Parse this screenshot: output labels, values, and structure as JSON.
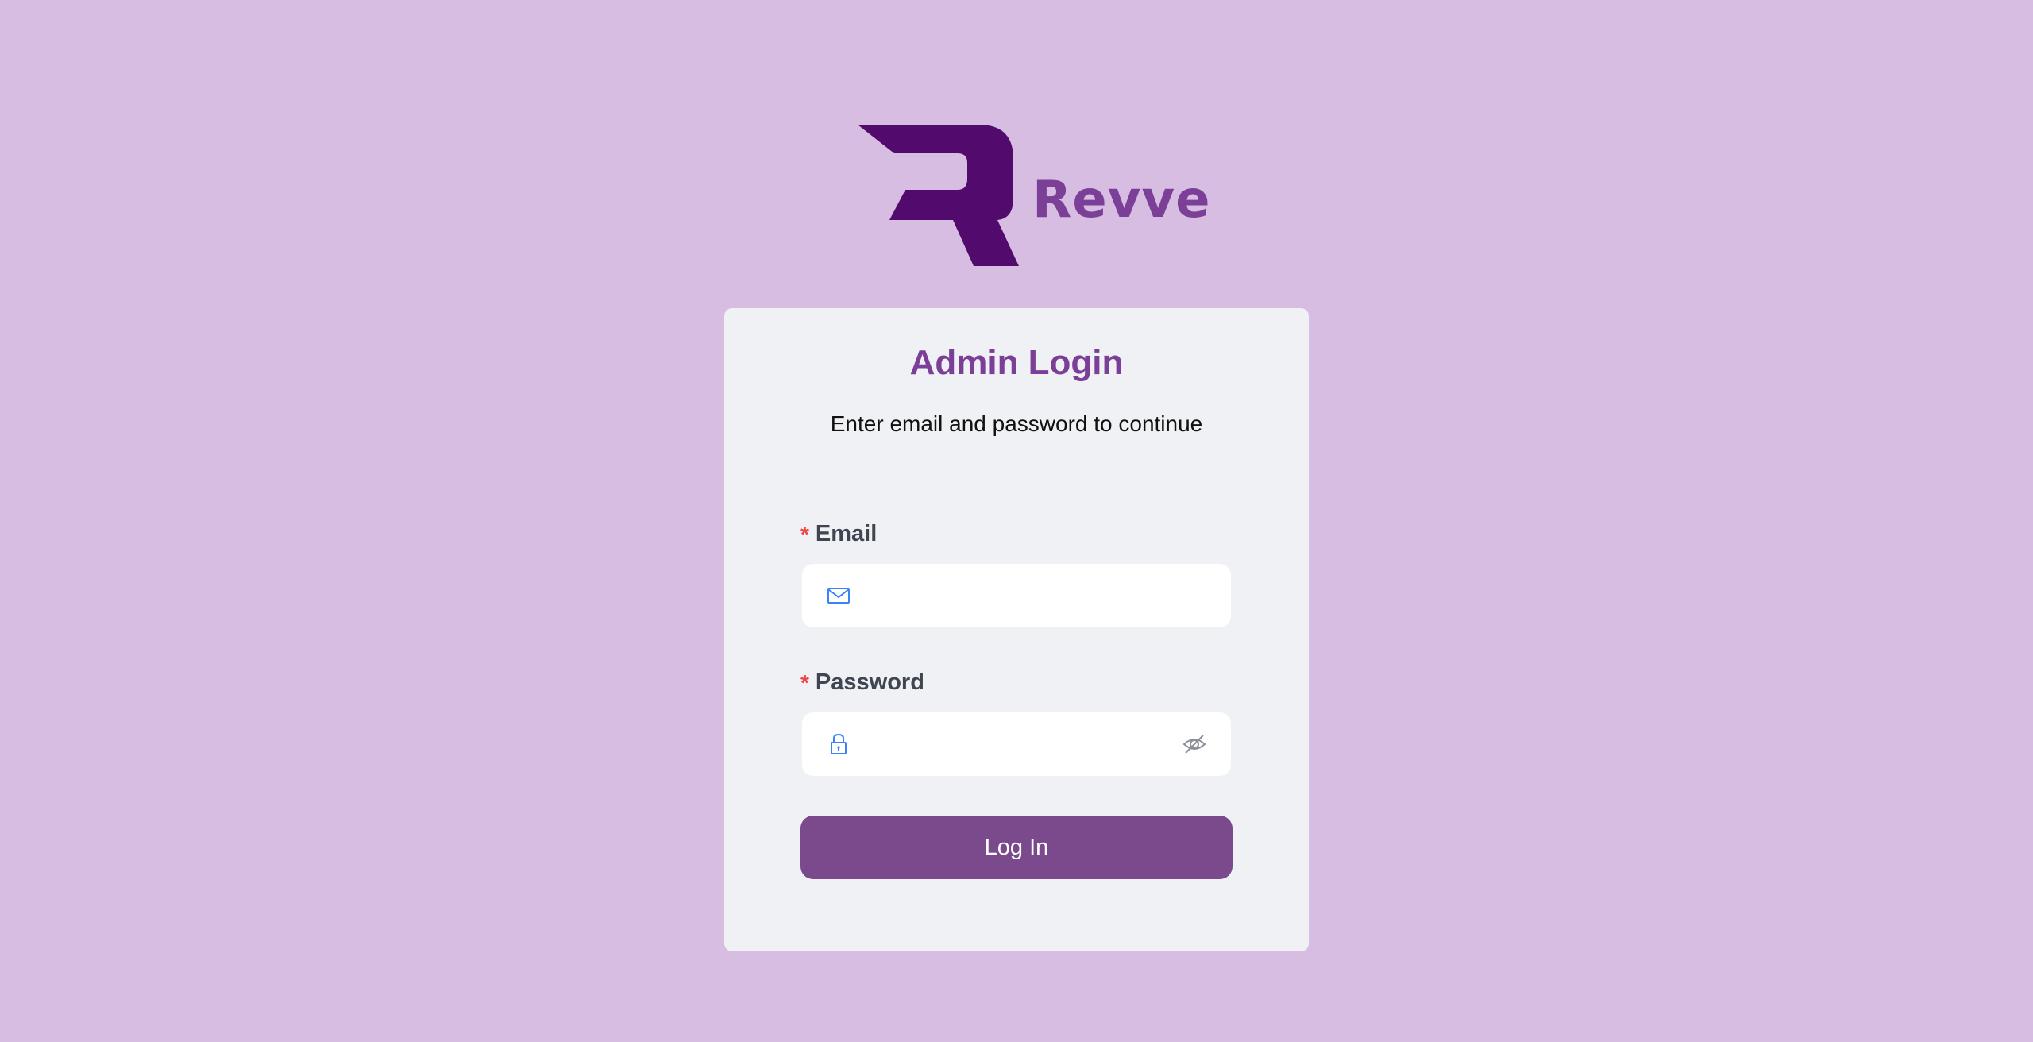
{
  "brand": {
    "name": "Revve",
    "mark_color": "#520a6d",
    "name_color": "#7c3f98"
  },
  "login": {
    "title": "Admin Login",
    "subtitle": "Enter email and password to continue",
    "title_color": "#7c3f98"
  },
  "fields": {
    "email": {
      "label": "Email",
      "required_marker": "*",
      "value": "",
      "icon": "mail-icon"
    },
    "password": {
      "label": "Password",
      "required_marker": "*",
      "value": "",
      "icon": "lock-icon",
      "toggle_icon": "eye-off-icon"
    }
  },
  "submit": {
    "label": "Log In",
    "color": "#7a4a8c"
  },
  "colors": {
    "background": "#d7bde2",
    "card": "#f0f1f5",
    "input_icon": "#3b82f6",
    "required": "#ef4444"
  }
}
